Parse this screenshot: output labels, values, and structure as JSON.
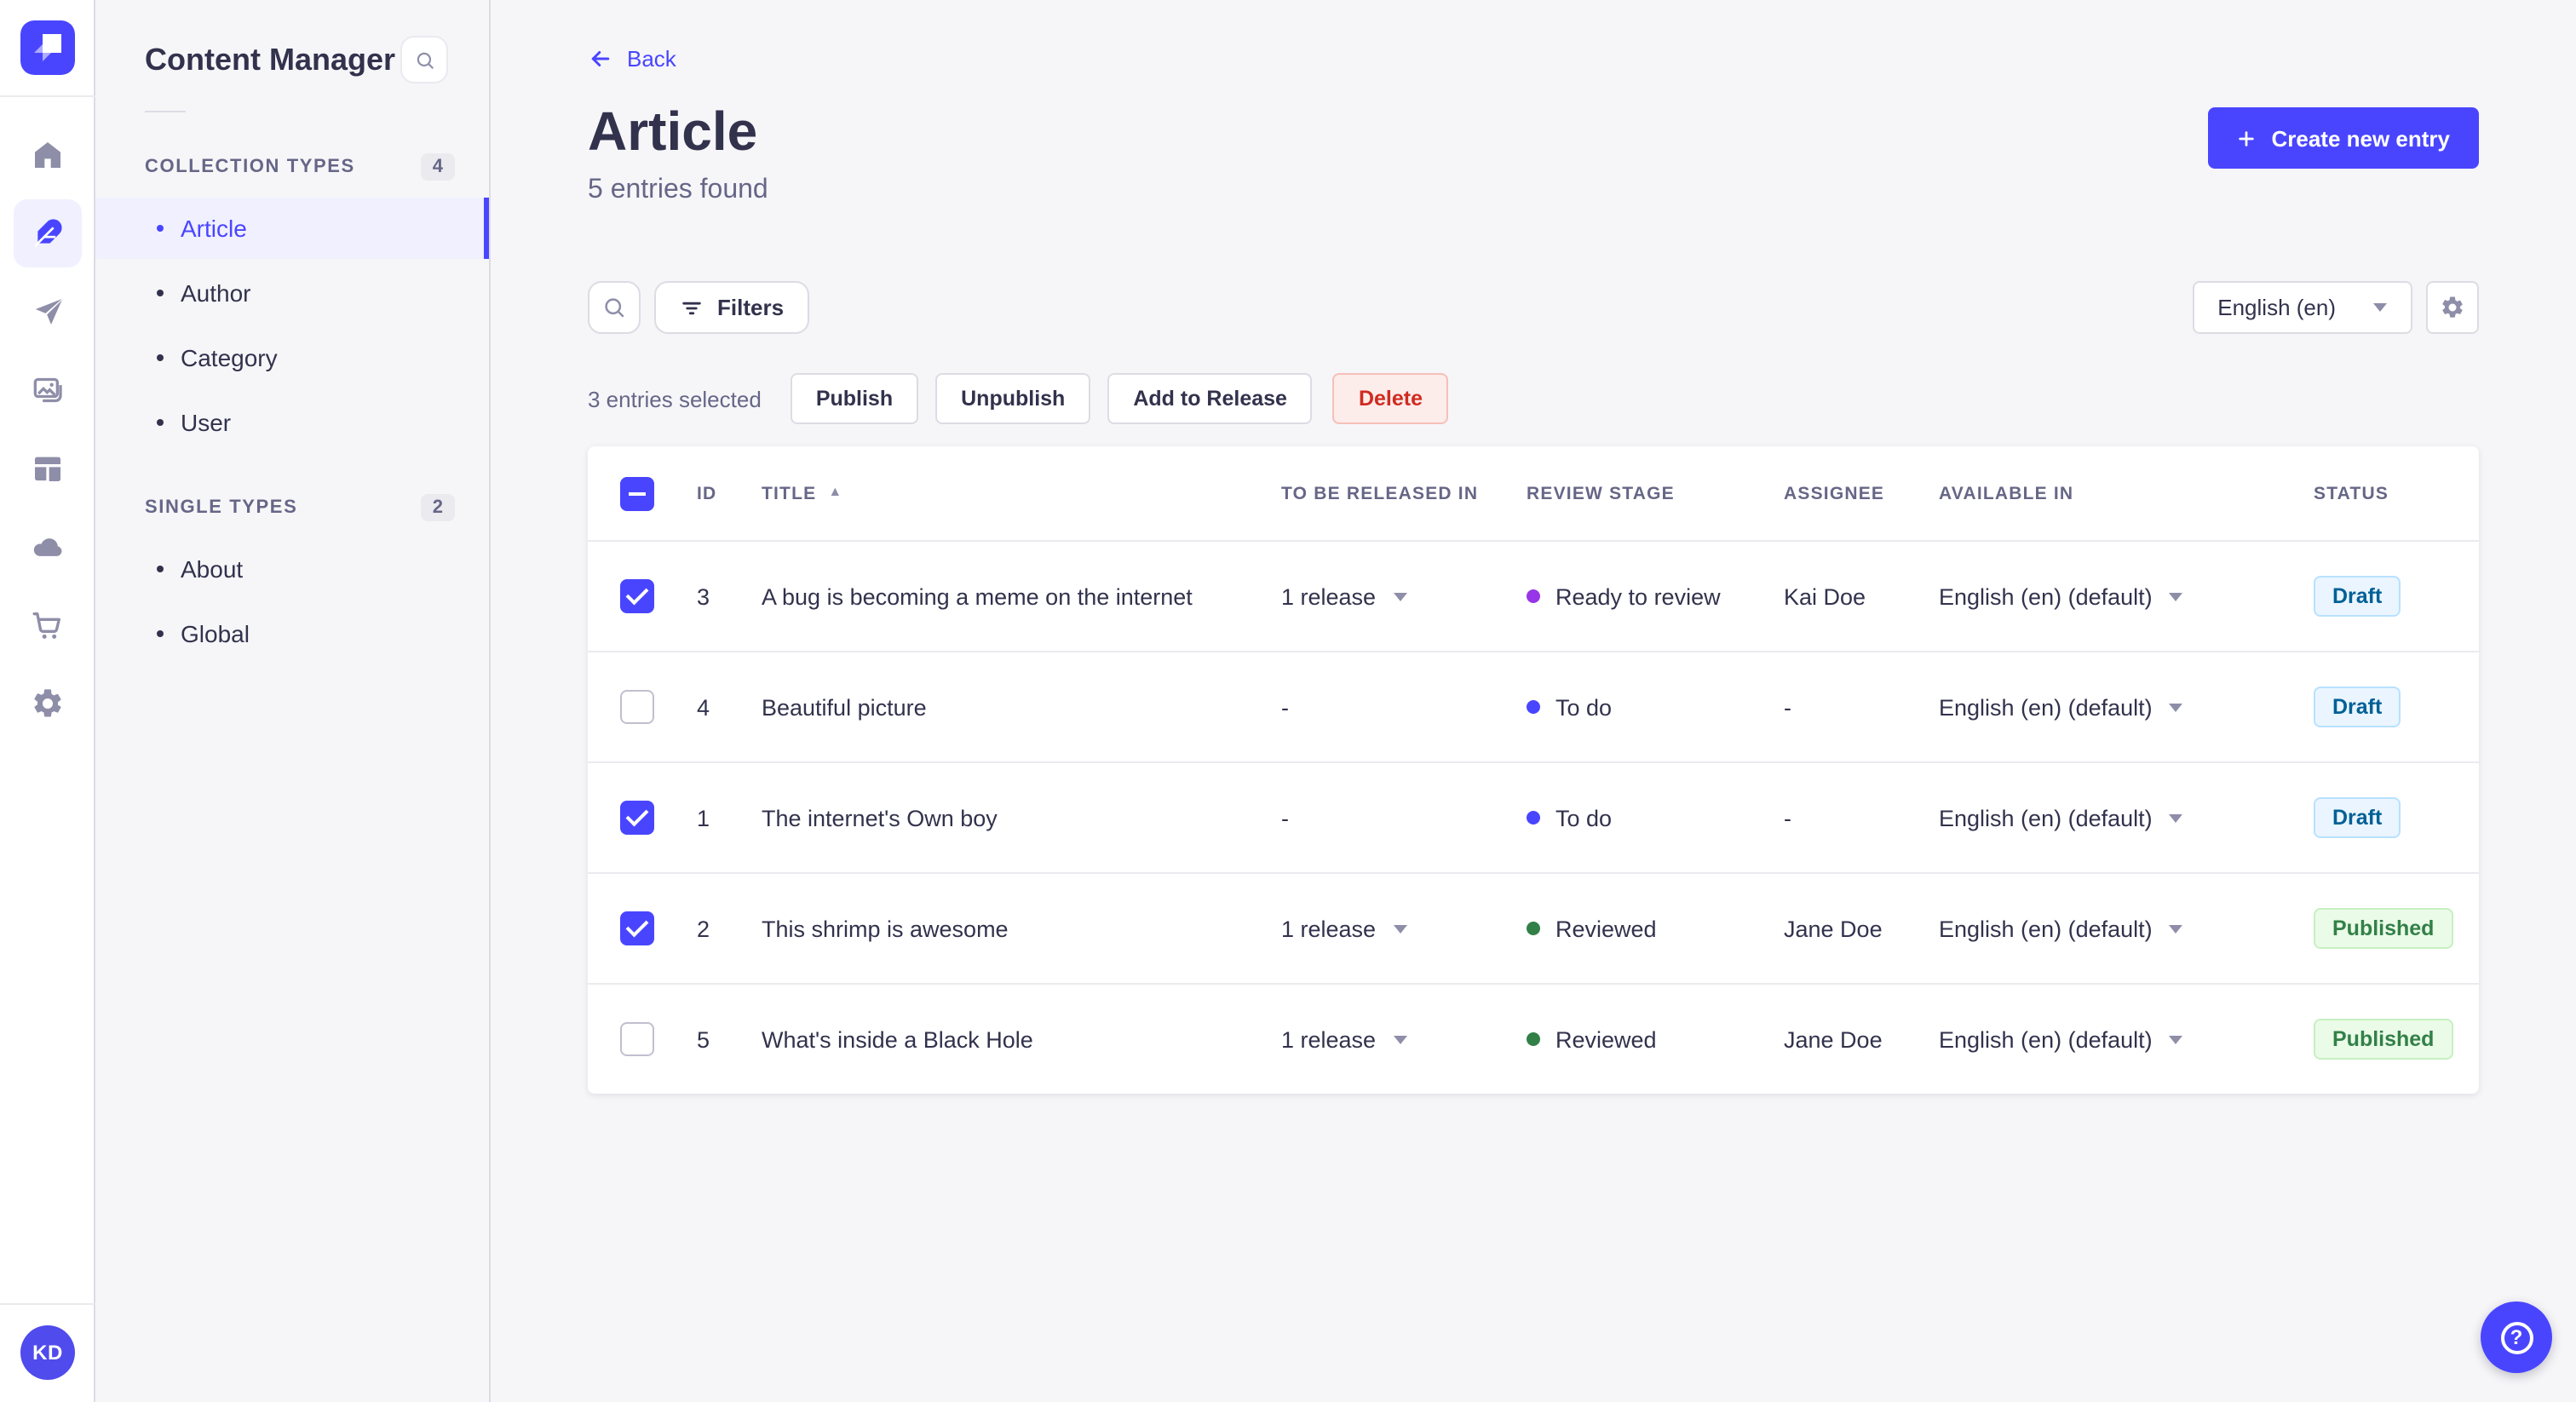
{
  "colors": {
    "brand": "#4945ff",
    "stage_ready_to_review": "#9736e8",
    "stage_to_do": "#4945ff",
    "stage_reviewed": "#328048"
  },
  "nav_rail": {
    "logo_icon": "strapi-logo",
    "icons": [
      "home-icon",
      "content-manager-feather-icon",
      "releases-paper-plane-icon",
      "media-library-icon",
      "content-type-builder-icon",
      "cloud-icon",
      "marketplace-cart-icon",
      "settings-gear-icon"
    ],
    "active_icon": "content-manager-feather-icon",
    "avatar_initials": "KD"
  },
  "subnav": {
    "title": "Content Manager",
    "search_icon": "search-icon",
    "sections": [
      {
        "label": "COLLECTION TYPES",
        "count": "4",
        "items": [
          {
            "label": "Article",
            "active": true
          },
          {
            "label": "Author",
            "active": false
          },
          {
            "label": "Category",
            "active": false
          },
          {
            "label": "User",
            "active": false
          }
        ]
      },
      {
        "label": "SINGLE TYPES",
        "count": "2",
        "items": [
          {
            "label": "About",
            "active": false
          },
          {
            "label": "Global",
            "active": false
          }
        ]
      }
    ]
  },
  "header": {
    "back_label": "Back",
    "title": "Article",
    "subtitle": "5 entries found",
    "create_button_label": "Create new entry"
  },
  "toolbar": {
    "filters_label": "Filters",
    "locale_value": "English (en)",
    "settings_icon": "gear-icon"
  },
  "selection": {
    "text": "3 entries selected",
    "actions": [
      "Publish",
      "Unpublish",
      "Add to Release"
    ],
    "delete_label": "Delete"
  },
  "table": {
    "headers": {
      "id": "ID",
      "title": "TITLE",
      "release": "TO BE RELEASED IN",
      "stage": "REVIEW STAGE",
      "assignee": "ASSIGNEE",
      "available": "AVAILABLE IN",
      "status": "STATUS"
    },
    "sorted_by": "TITLE",
    "sort_direction": "asc",
    "select_all_state": "indeterminate",
    "rows": [
      {
        "checked": true,
        "id": "3",
        "title": "A bug is becoming a meme on the internet",
        "release": "1 release",
        "stage": "Ready to review",
        "stage_color": "#9736e8",
        "assignee": "Kai Doe",
        "available": "English (en) (default)",
        "status": "Draft"
      },
      {
        "checked": false,
        "id": "4",
        "title": "Beautiful picture",
        "release": "-",
        "stage": "To do",
        "stage_color": "#4945ff",
        "assignee": "-",
        "available": "English (en) (default)",
        "status": "Draft"
      },
      {
        "checked": true,
        "id": "1",
        "title": "The internet's Own boy",
        "release": "-",
        "stage": "To do",
        "stage_color": "#4945ff",
        "assignee": "-",
        "available": "English (en) (default)",
        "status": "Draft"
      },
      {
        "checked": true,
        "id": "2",
        "title": "This shrimp is awesome",
        "release": "1 release",
        "stage": "Reviewed",
        "stage_color": "#328048",
        "assignee": "Jane Doe",
        "available": "English (en) (default)",
        "status": "Published"
      },
      {
        "checked": false,
        "id": "5",
        "title": "What's inside a Black Hole",
        "release": "1 release",
        "stage": "Reviewed",
        "stage_color": "#328048",
        "assignee": "Jane Doe",
        "available": "English (en) (default)",
        "status": "Published"
      }
    ]
  },
  "help_fab": {
    "icon": "question-mark-icon"
  }
}
